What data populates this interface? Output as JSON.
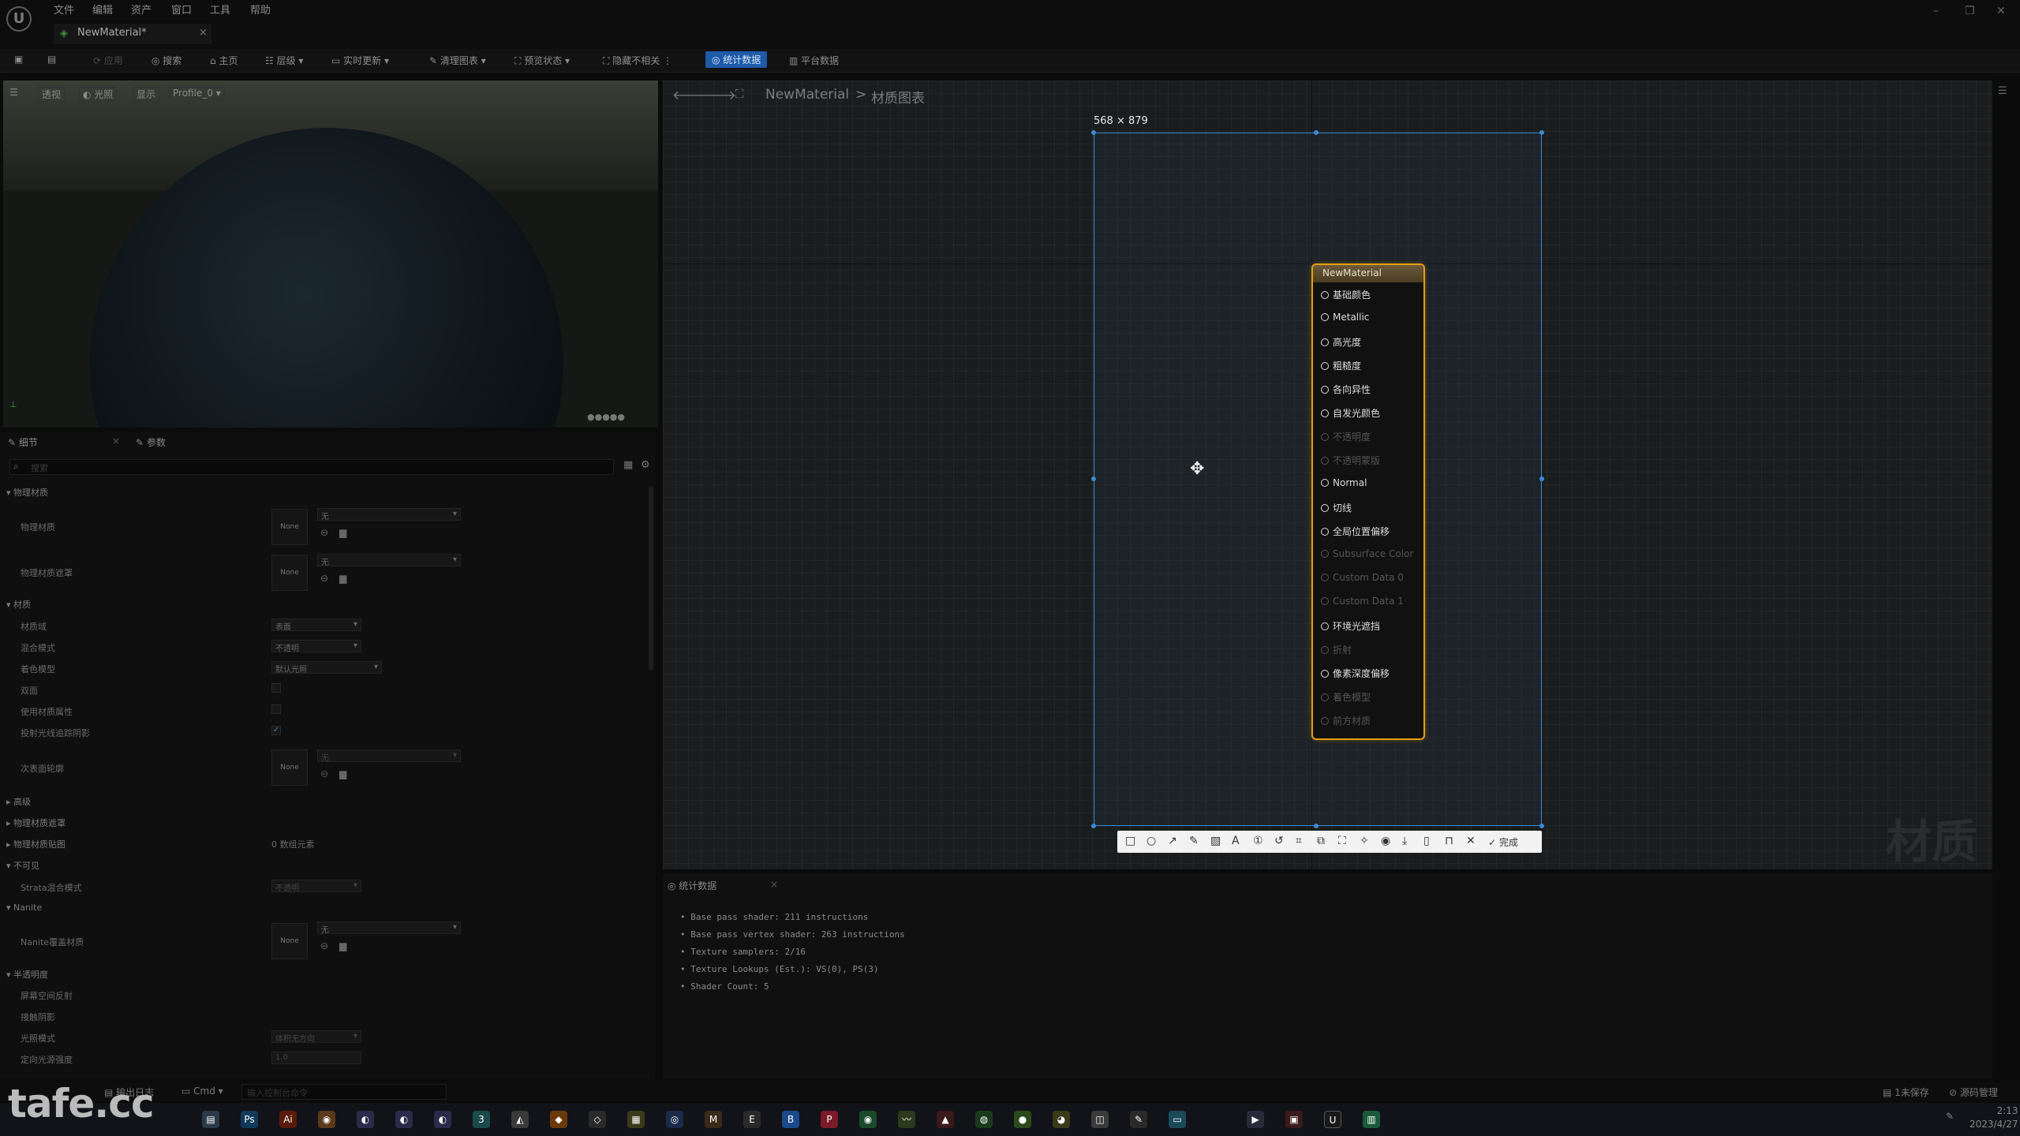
{
  "app": {
    "menu": [
      "文件",
      "编辑",
      "资产",
      "窗口",
      "工具",
      "帮助"
    ],
    "tab_title": "NewMaterial*"
  },
  "toolbar": {
    "items": [
      {
        "label": "应用",
        "dim": true
      },
      {
        "label": "搜索"
      },
      {
        "label": "主页"
      },
      {
        "label": "层级"
      },
      {
        "label": "实时更新"
      },
      {
        "label": "清理图表"
      },
      {
        "label": "预览状态"
      },
      {
        "label": "隐藏不相关"
      },
      {
        "label": "统计数据",
        "active": true
      },
      {
        "label": "平台数据"
      }
    ]
  },
  "viewport": {
    "buttons": [
      "透视",
      "光照",
      "显示",
      "Profile_0"
    ]
  },
  "details": {
    "tabs": [
      "细节",
      "参数"
    ],
    "search_placeholder": "搜索",
    "rows": [
      {
        "label": "物理材质",
        "section": true
      },
      {
        "label": "物理材质",
        "value": "无",
        "thumb": "None"
      },
      {
        "label": "物理材质遮罩",
        "value": "无",
        "thumb": "None"
      },
      {
        "label": "材质",
        "section": true
      },
      {
        "label": "材质域",
        "value": "表面"
      },
      {
        "label": "混合模式",
        "value": "不透明"
      },
      {
        "label": "着色模型",
        "value": "默认光照"
      },
      {
        "label": "双面"
      },
      {
        "label": "使用材质属性"
      },
      {
        "label": "投射光线追踪阴影",
        "checked": true
      },
      {
        "label": "次表面轮廓",
        "value": "无",
        "thumb": "None"
      },
      {
        "label": "高级",
        "section": true
      },
      {
        "label": "物理材质遮罩",
        "section": true
      },
      {
        "label": "物理材质贴图",
        "value": "0 数组元素",
        "section": true
      },
      {
        "label": "不可见",
        "section": true
      },
      {
        "label": "Strata混合模式",
        "value": "不透明"
      },
      {
        "label": "Nanite",
        "section": true
      },
      {
        "label": "Nanite覆盖材质",
        "value": "无",
        "thumb": "None"
      },
      {
        "label": "半透明度",
        "section": true
      },
      {
        "label": "屏幕空间反射"
      },
      {
        "label": "接触阴影"
      },
      {
        "label": "光照模式",
        "value": "体积无方向"
      },
      {
        "label": "定向光源强度",
        "value": "1.0"
      }
    ]
  },
  "graph": {
    "breadcrumb_root": "NewMaterial",
    "breadcrumb_sep": ">",
    "breadcrumb_page": "材质图表",
    "watermark": "材质",
    "selection_size": "568 × 879",
    "node": {
      "title": "NewMaterial",
      "pins": [
        {
          "label": "基础颜色",
          "active": true
        },
        {
          "label": "Metallic",
          "active": true
        },
        {
          "label": "高光度",
          "active": true
        },
        {
          "label": "粗糙度",
          "active": true
        },
        {
          "label": "各向异性",
          "active": true
        },
        {
          "label": "自发光颜色",
          "active": true
        },
        {
          "label": "不透明度",
          "active": false
        },
        {
          "label": "不透明蒙版",
          "active": false
        },
        {
          "label": "Normal",
          "active": true
        },
        {
          "label": "切线",
          "active": true
        },
        {
          "label": "全局位置偏移",
          "active": true
        },
        {
          "label": "Subsurface Color",
          "active": false
        },
        {
          "label": "Custom Data 0",
          "active": false
        },
        {
          "label": "Custom Data 1",
          "active": false
        },
        {
          "label": "环境光遮挡",
          "active": true
        },
        {
          "label": "折射",
          "active": false
        },
        {
          "label": "像素深度偏移",
          "active": true
        },
        {
          "label": "着色模型",
          "active": false
        },
        {
          "label": "前方材质",
          "active": false
        }
      ]
    },
    "annotation_tools": [
      "square-icon",
      "circle-icon",
      "arrow-icon",
      "pen-icon",
      "mosaic-icon",
      "text-icon",
      "number-icon",
      "undo-icon",
      "crop-icon",
      "copy-icon",
      "fullscreen-icon",
      "pin-icon",
      "record-icon",
      "download-icon",
      "save-icon",
      "bookmark-icon",
      "close-icon"
    ],
    "annotation_done": "完成"
  },
  "stats": {
    "tab": "统计数据",
    "lines": [
      "Base pass shader: 211 instructions",
      "Base pass vertex shader: 263 instructions",
      "Texture samplers: 2/16",
      "Texture Lookups (Est.): VS(0), PS(3)",
      "Shader Count: 5"
    ]
  },
  "bottombar": {
    "output_log": "输出日志",
    "cmd": "Cmd",
    "cmd_placeholder": "输入控制台命令",
    "unsaved": "1未保存",
    "source_control": "源码管理"
  },
  "taskbar": {
    "time": "2:13",
    "date": "2023/4/27",
    "brand": "tafe.cc"
  }
}
